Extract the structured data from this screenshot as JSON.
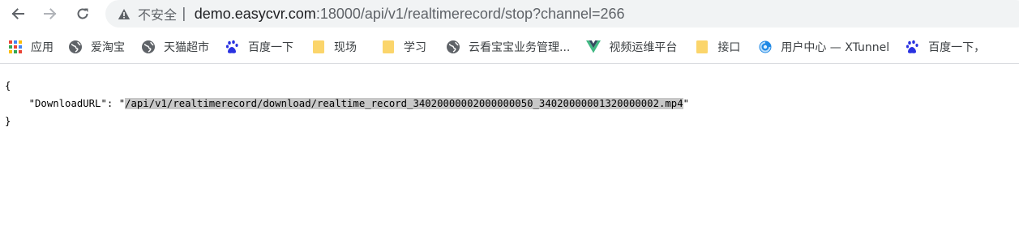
{
  "browser": {
    "security_label": "不安全",
    "separator": "|",
    "url_host": "demo.easycvr.com",
    "url_rest": ":18000/api/v1/realtimerecord/stop?channel=266"
  },
  "bookmarks": [
    {
      "label": "应用",
      "icon": "apps-grid-icon"
    },
    {
      "label": "爱淘宝",
      "icon": "globe-icon"
    },
    {
      "label": "天猫超市",
      "icon": "globe-icon"
    },
    {
      "label": "百度一下",
      "icon": "baidu-paw-icon"
    },
    {
      "label": "现场",
      "icon": "folder-icon"
    },
    {
      "label": "学习",
      "icon": "folder-icon"
    },
    {
      "label": "云看宝宝业务管理...",
      "icon": "globe-icon"
    },
    {
      "label": "视频运维平台",
      "icon": "vue-logo-icon"
    },
    {
      "label": "接口",
      "icon": "folder-icon"
    },
    {
      "label": "用户中心 — XTunnel",
      "icon": "swirl-icon"
    },
    {
      "label": "百度一下，",
      "icon": "baidu-paw-icon"
    }
  ],
  "json_body": {
    "open_brace": "{",
    "key": "\"DownloadURL\"",
    "colon": ": ",
    "quote_open": "\"",
    "value": "/api/v1/realtimerecord/download/realtime_record_34020000002000000050_34020000001320000002.mp4",
    "quote_close": "\"",
    "close_brace": "}"
  },
  "colors": {
    "omnibox_bg": "#f1f3f4",
    "bookmark_bar_border": "#dadce0",
    "selection_highlight": "#c8c8c8",
    "folder_yellow": "#fbd56b",
    "vue_green": "#41b883",
    "vue_dark": "#35495e",
    "baidu_blue": "#2932e1"
  }
}
